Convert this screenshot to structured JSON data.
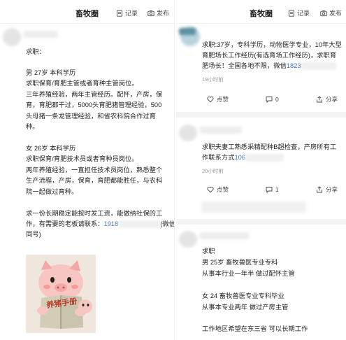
{
  "left": {
    "header": {
      "title": "畜牧圈",
      "record": "记录",
      "publish": "发布"
    },
    "post": {
      "lines": [
        "求职：",
        "",
        "男 27岁 本科学历",
        "求职保育/育肥主管或者育种主管岗位。",
        "三年养殖经验，两年主管经历。配怀，产房，保",
        "育，育肥都干过，5000头育肥猪管理经验，500",
        "头母猪一条龙管理经验，和省农科院合作过育",
        "种。",
        "",
        "女 26岁 本科学历",
        "求职保育/育肥技术员或者育种员岗位。",
        "两年养殖经验，一直担任技术员岗位，熟悉整个",
        "生产流程，产房，保育，育肥都能胜任，与农科",
        "院一起做过育种。",
        "",
        "求一份长期稳定能按时发工资，能做纳社保的工",
        "作，有需要的老板请联系："
      ],
      "phone": "1918",
      "phone_suffix": "(微信",
      "last_line": "同号)",
      "sticker_text": "养猪手册"
    }
  },
  "right": {
    "header": {
      "title": "畜牧圈",
      "record": "记录",
      "publish": "发布"
    },
    "posts": [
      {
        "lines": [
          "求职:37岁，专科学历，动物医学专业，10年大型",
          "育肥场长工作经历(有选育场工作经历)，求职育",
          "肥场长！全国各地不限，微信"
        ],
        "phone": "1823",
        "time": "19小时前",
        "like": "点赞",
        "comment": "0",
        "share": "分享"
      },
      {
        "lines": [
          "求职夫妻工熟悉采精配种B超检查，产房所有工",
          "作联系方式"
        ],
        "phone": "106",
        "time": "20小时前",
        "like": "点赞",
        "comment": "1",
        "share": "分享"
      },
      {
        "lines": [
          "求职",
          "男  25岁  畜牧兽医专业专科",
          "从事本行业一年半  做过配怀主管",
          "",
          "女  24  畜牧兽医专业专科毕业",
          "从事本专业两年  做过产房主管",
          "",
          "工作地区希望在东三省  可以长期工作"
        ]
      }
    ]
  }
}
